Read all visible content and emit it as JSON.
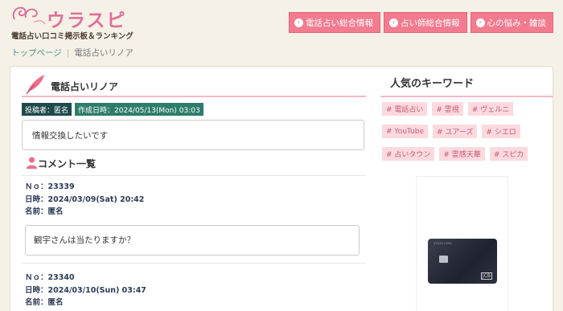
{
  "header": {
    "logo_text": "ウラスピ",
    "logo_sub": "電話占い口コミ掲示板＆ランキング",
    "nav": [
      {
        "label": "電話占い総合情報"
      },
      {
        "label": "占い師総合情報"
      },
      {
        "label": "心の悩み・雑談"
      }
    ]
  },
  "breadcrumb": {
    "home": "トップページ",
    "current": "電話占いリノア"
  },
  "thread": {
    "title": "電話占いリノア",
    "author_tag": "投稿者：匿名",
    "date_tag": "作成日時：2024/05/13(Mon) 03:03",
    "body": "情報交換したいです"
  },
  "comments_title": "コメント一覧",
  "comments": [
    {
      "no": "Ｎｏ：23339",
      "date": "日時：2024/03/09(Sat) 20:42",
      "name": "名前：匿名",
      "body": "観宇さんは当たりますか？"
    },
    {
      "no": "Ｎｏ：23340",
      "date": "日時：2024/03/10(Sun) 03:47",
      "name": "名前：匿名",
      "body": ""
    }
  ],
  "sidebar": {
    "keywords_title": "人気のキーワード",
    "keywords": [
      "# 電話占い",
      "# 霊視",
      "# ヴェルニ",
      "# YouTube",
      "# ユアーズ",
      "# シエロ",
      "# 占いタウン",
      "# 霊感天華",
      "# スピカ"
    ]
  },
  "ad": {
    "card_text": "XXXXX CARD"
  },
  "colors": {
    "accent_pink": "#f27b8f",
    "tag_dark": "#1f4a4b",
    "tag_green": "#2e7d6b",
    "keyword_bg": "#fbd9df"
  }
}
